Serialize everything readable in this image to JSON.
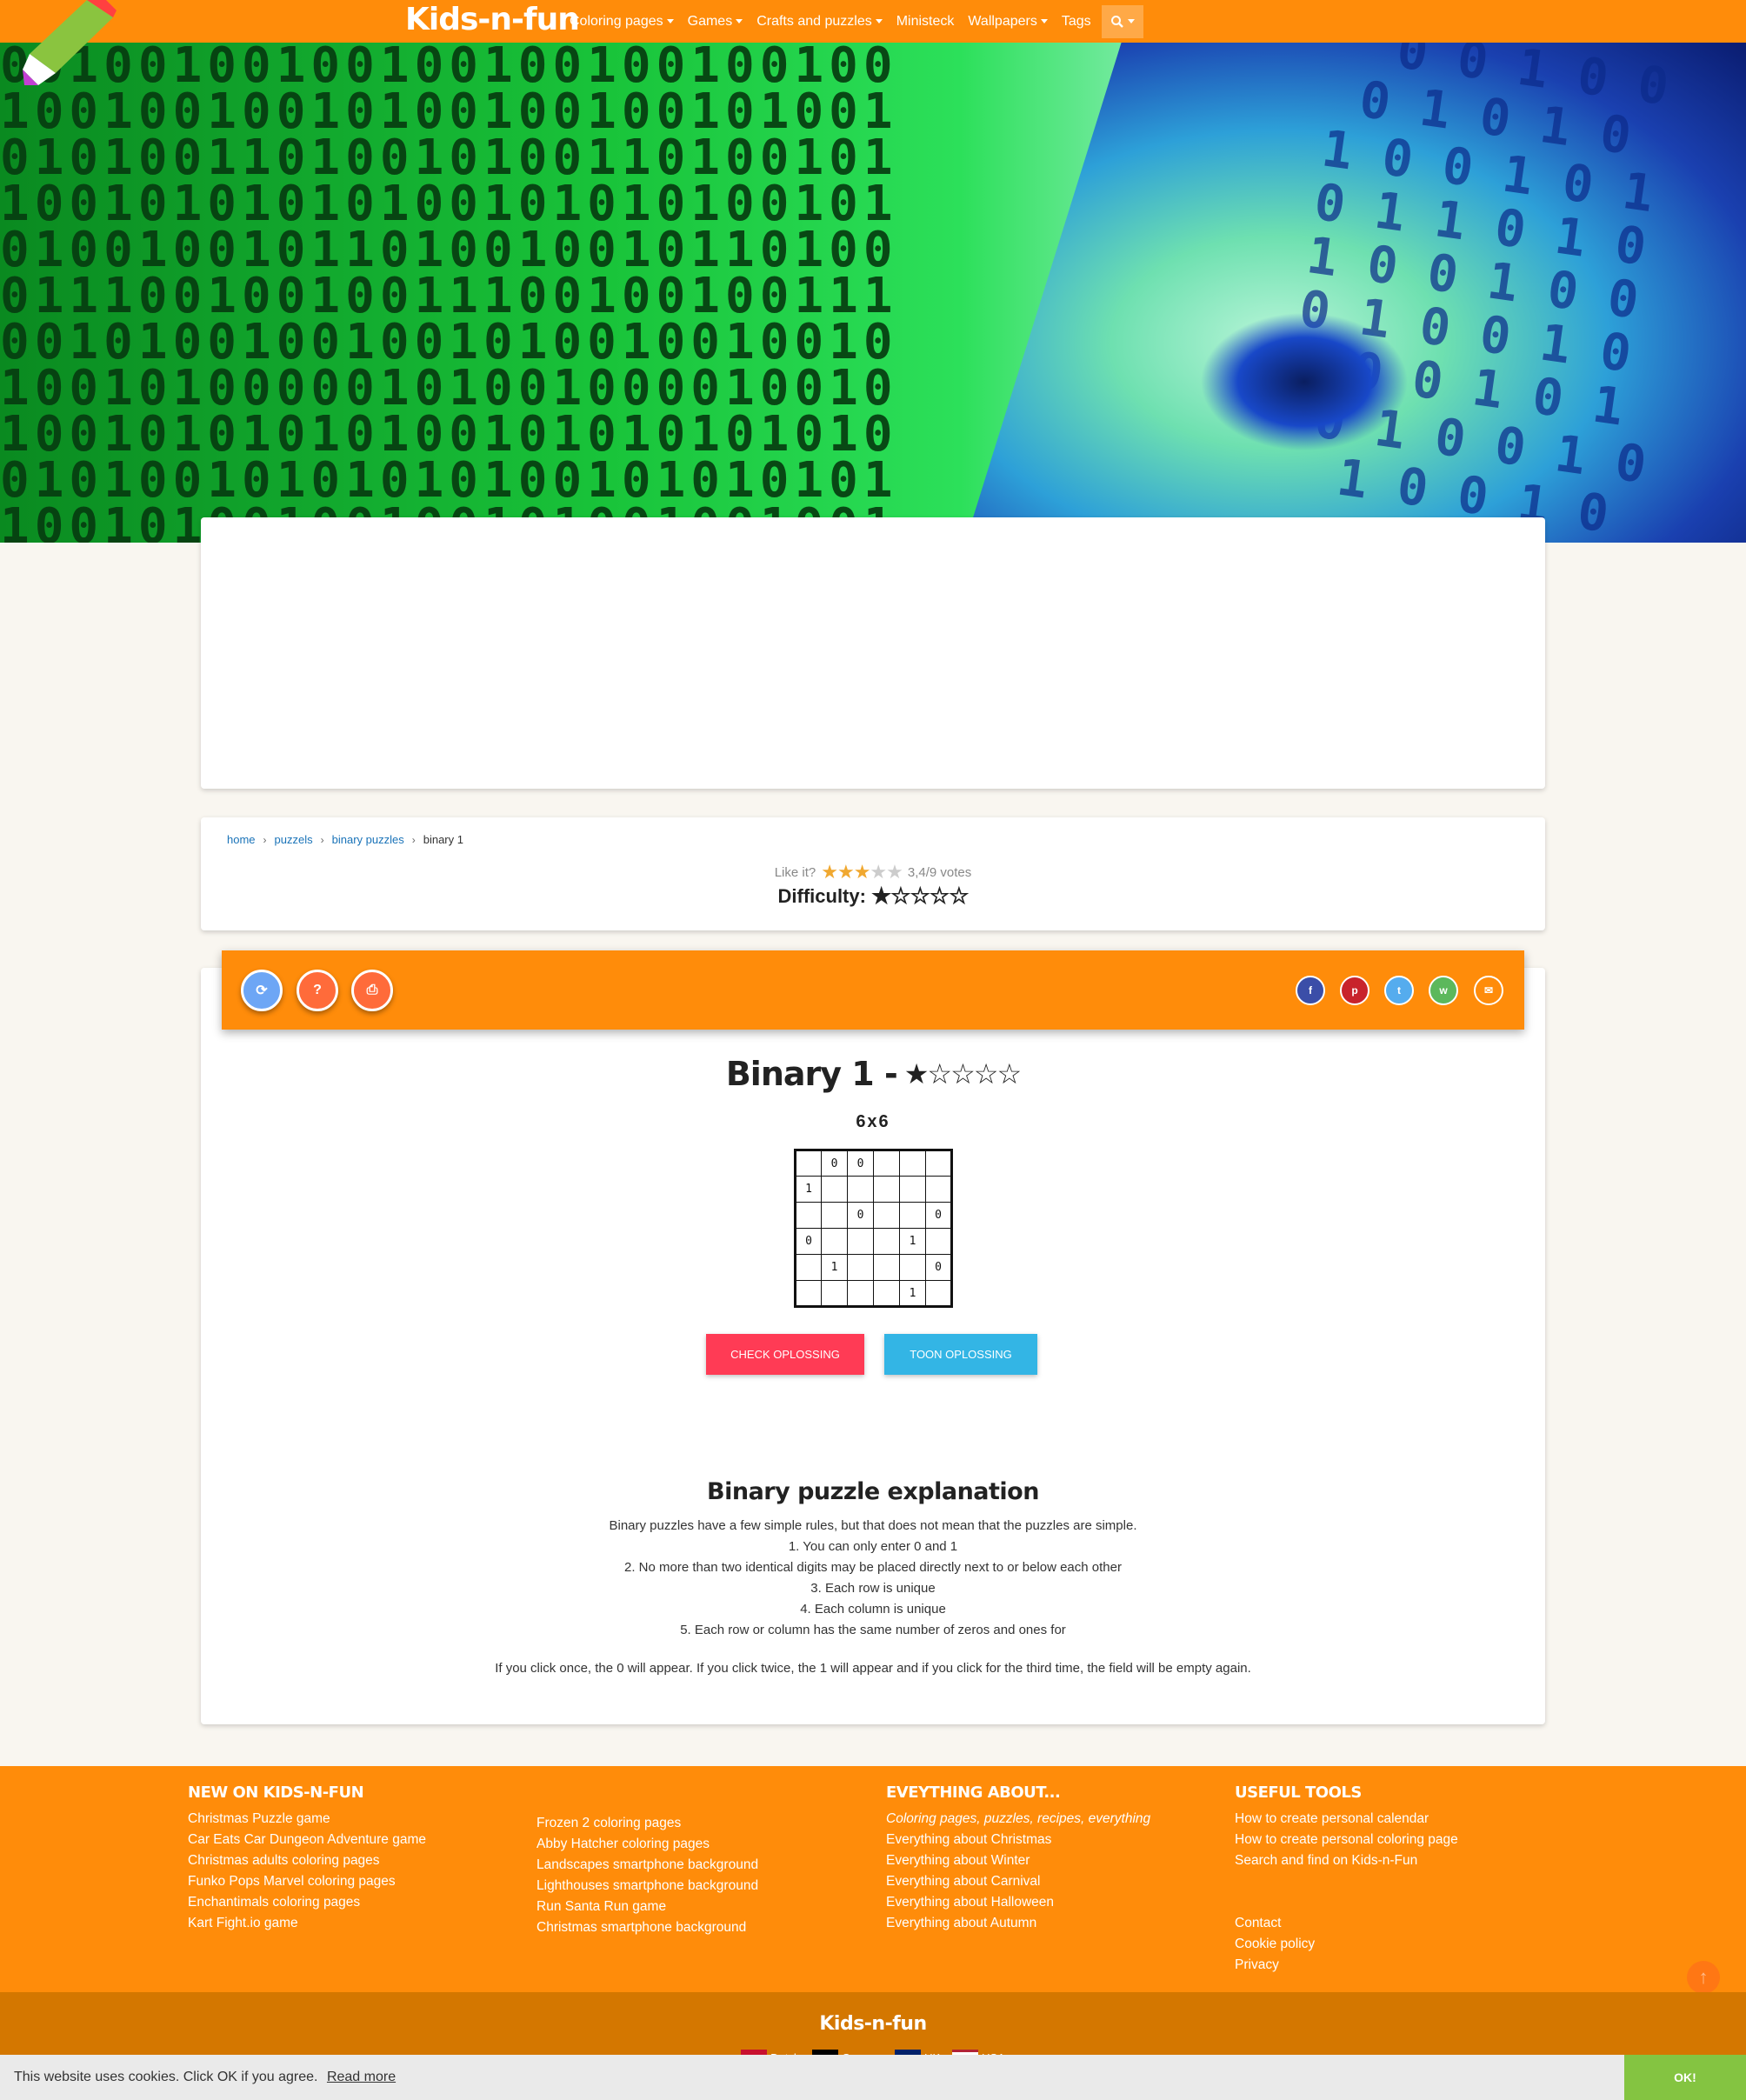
{
  "nav": {
    "brand": "Kids-n-fun",
    "items": [
      {
        "label": "Coloring pages",
        "dropdown": true
      },
      {
        "label": "Games",
        "dropdown": true
      },
      {
        "label": "Crafts and puzzles",
        "dropdown": true
      },
      {
        "label": "Ministeck",
        "dropdown": false
      },
      {
        "label": "Wallpapers",
        "dropdown": true
      },
      {
        "label": "Tags",
        "dropdown": false
      }
    ],
    "search_icon": "search-icon"
  },
  "breadcrumb": {
    "items": [
      "home",
      "puzzels",
      "binary puzzles"
    ],
    "current": "binary 1",
    "separator": "›"
  },
  "rating": {
    "prompt": "Like it?",
    "stars_on": "★★★",
    "stars_off": "★★",
    "value": 3.4,
    "max": 5,
    "votes_text": "3,4/9 votes"
  },
  "difficulty": {
    "label": "Difficulty:",
    "stars": "★☆☆☆☆",
    "level": 1,
    "max": 5
  },
  "toolbar": {
    "refresh": "⟳",
    "help": "?",
    "print": "⎙",
    "share": {
      "facebook": "f",
      "pinterest": "p",
      "twitter": "t",
      "whatsapp": "w",
      "mail": "✉"
    },
    "colors": {
      "refresh": "#6da6f5",
      "help": "#ff6b3a",
      "print": "#ff6b3a",
      "facebook": "#3b4ea8",
      "pinterest": "#c8232c",
      "twitter": "#55acee",
      "whatsapp": "#5cb85c"
    }
  },
  "puzzle": {
    "title": "Binary 1 -",
    "title_stars": "★☆☆☆☆",
    "size": "6x6",
    "grid": [
      [
        "",
        "0",
        "0",
        "",
        "",
        ""
      ],
      [
        "1",
        "",
        "",
        "",
        "",
        ""
      ],
      [
        "",
        "",
        "0",
        "",
        "",
        "0"
      ],
      [
        "0",
        "",
        "",
        "",
        "1",
        ""
      ],
      [
        "",
        "1",
        "",
        "",
        "",
        "0"
      ],
      [
        "",
        "",
        "",
        "",
        "1",
        ""
      ]
    ],
    "check_button": "Check oplossing",
    "show_button": "Toon oplossing"
  },
  "explanation": {
    "title": "Binary puzzle explanation",
    "lines": [
      "Binary puzzles have a few simple rules, but that does not mean that the puzzles are simple.",
      "1. You can only enter 0 and 1",
      "2. No more than two identical digits may be placed directly next to or below each other",
      "3. Each row is unique",
      "4. Each column is unique",
      "5. Each row or column has the same number of zeros and ones for"
    ],
    "note": "If you click once, the 0 will appear. If you click twice, the 1 will appear and if you click for the third time, the field will be empty again."
  },
  "footer": {
    "col1": {
      "title": "NEW ON KIDS-N-FUN",
      "links": [
        "Christmas Puzzle game",
        "Car Eats Car Dungeon Adventure game",
        "Christmas adults coloring pages",
        "Funko Pops Marvel coloring pages",
        "Enchantimals coloring pages",
        "Kart Fight.io game"
      ]
    },
    "col2": {
      "links": [
        "Frozen 2 coloring pages",
        "Abby Hatcher coloring pages",
        "Landscapes smartphone background",
        "Lighthouses smartphone background",
        "Run Santa Run game",
        "Christmas smartphone background"
      ]
    },
    "col3": {
      "title": "EVEYTHING ABOUT...",
      "subtitle": "Coloring pages, puzzles, recipes, everything",
      "links": [
        "Everything about Christmas",
        "Everything about Winter",
        "Everything about Carnival",
        "Everything about Halloween",
        "Everything about Autumn"
      ]
    },
    "col4": {
      "title": "USEFUL TOOLS",
      "links": [
        "How to create personal calendar",
        "How to create personal coloring page",
        "Search and find on Kids-n-Fun"
      ],
      "links2": [
        "Contact",
        "Cookie policy",
        "Privacy"
      ]
    },
    "brand": "Kids-n-fun",
    "languages": [
      "Dutch",
      "German",
      "UK",
      "USA"
    ]
  },
  "cookie": {
    "text": "This website uses cookies. Click OK if you agree.",
    "read_more": "Read more",
    "ok": "OK!"
  },
  "colors": {
    "primary": "#ff8c0a",
    "footer_dark": "#d47700",
    "check": "#ff3b55",
    "show": "#33b5e5",
    "ok": "#84c441"
  }
}
